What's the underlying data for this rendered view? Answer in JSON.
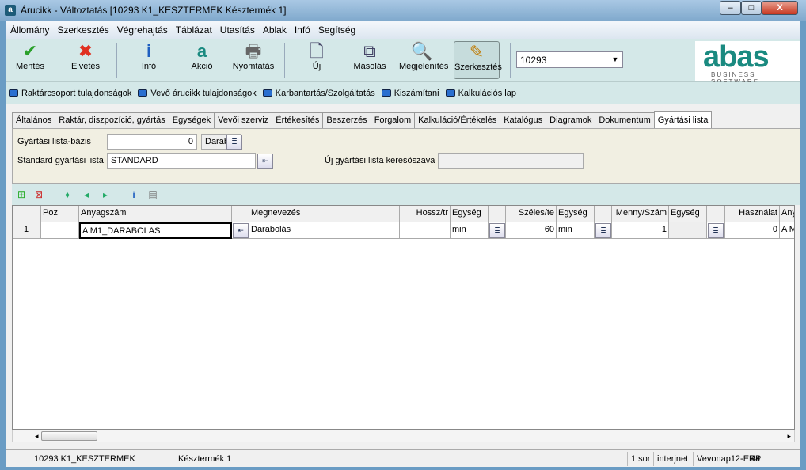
{
  "window": {
    "title": "Árucikk - Változtatás  [10293   K1_KESZTERMEK   Késztermék 1]",
    "minimize": "–",
    "maximize": "□",
    "close": "X"
  },
  "menu": [
    "Állomány",
    "Szerkesztés",
    "Végrehajtás",
    "Táblázat",
    "Utasítás",
    "Ablak",
    "Infó",
    "Segítség"
  ],
  "toolbar": {
    "buttons": [
      {
        "label": "Mentés",
        "icon": "check-icon",
        "glyph": "✔",
        "color": "#2aa02a"
      },
      {
        "label": "Elvetés",
        "icon": "x-icon",
        "glyph": "✖",
        "color": "#e03020"
      },
      {
        "label": "Infó",
        "icon": "info-icon",
        "glyph": "i",
        "color": "#1f5fc0"
      },
      {
        "label": "Akció",
        "icon": "action-icon",
        "glyph": "a",
        "color": "#1a8a80"
      },
      {
        "label": "Nyomtatás",
        "icon": "printer-icon",
        "glyph": "🖶",
        "color": "#666"
      },
      {
        "label": "Új",
        "icon": "new-document-icon",
        "glyph": "🗋",
        "color": "#446"
      },
      {
        "label": "Másolás",
        "icon": "copy-icon",
        "glyph": "⧉",
        "color": "#446"
      },
      {
        "label": "Megjelenítés",
        "icon": "magnifier-icon",
        "glyph": "🔍",
        "color": "#664"
      },
      {
        "label": "Szerkesztés",
        "icon": "edit-icon",
        "glyph": "✎",
        "color": "#c08010"
      }
    ],
    "combo_value": "10293"
  },
  "logo": {
    "text": "abas",
    "sub": "BUSINESS SOFTWARE",
    "color": "#1a8a80"
  },
  "links": [
    "Raktárcsoport tulajdonságok",
    "Vevő árucikk tulajdonságok",
    "Karbantartás/Szolgáltatás",
    "Kiszámítani",
    "Kalkulációs lap"
  ],
  "tabs": [
    "Általános",
    "Raktár, diszpozíció, gyártás",
    "Egységek",
    "Vevői szerviz",
    "Értékesítés",
    "Beszerzés",
    "Forgalom",
    "Kalkuláció/Értékelés",
    "Katalógus",
    "Diagramok",
    "Dokumentum",
    "Gyártási lista"
  ],
  "selected_tab": "Gyártási lista",
  "form": {
    "base_label": "Gyártási lista-bázis",
    "base_value": "0",
    "base_unit": "Darab",
    "std_label": "Standard gyártási lista",
    "std_value": "STANDARD",
    "new_kw_label": "Új gyártási lista keresőszava",
    "new_kw_value": ""
  },
  "grid": {
    "headers": [
      "",
      "Poz",
      "Anyagszám",
      "",
      "Megnevezés",
      "Hossz/tr",
      "Egység",
      "",
      "Széles/te",
      "Egység",
      "",
      "Menny/Szám",
      "Egység",
      "",
      "Használat",
      "Any"
    ],
    "rows": [
      [
        "1",
        "",
        "A M1_DARABOLAS",
        "",
        "Darabolás",
        "",
        "min",
        "",
        "60",
        "min",
        "",
        "1",
        "",
        "",
        "0",
        "A M"
      ]
    ]
  },
  "status": {
    "item": "10293 K1_KESZTERMEK",
    "name": "Késztermék 1",
    "rows": "1 sor",
    "user": "interjnet",
    "system": "Vevonap12-ERP",
    "num": "44"
  }
}
